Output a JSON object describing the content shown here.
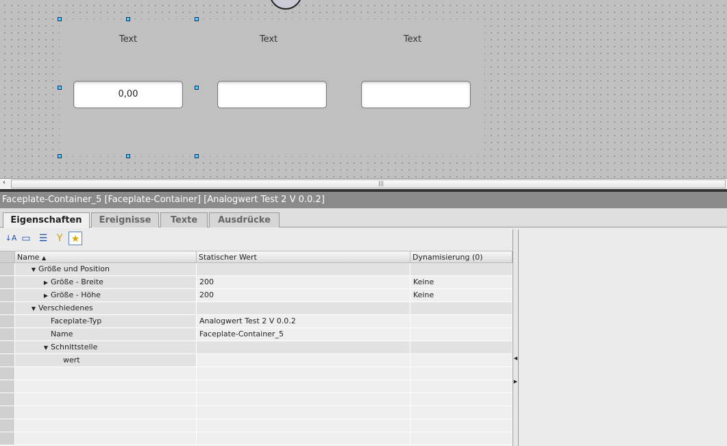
{
  "canvas": {
    "faceplates": [
      {
        "label": "Text",
        "value": "0,00"
      },
      {
        "label": "Text",
        "value": ""
      },
      {
        "label": "Text",
        "value": ""
      }
    ]
  },
  "inspector": {
    "title": "Faceplate-Container_5 [Faceplate-Container] [Analogwert Test 2 V 0.0.2]",
    "tabs": [
      "Eigenschaften",
      "Ereignisse",
      "Texte",
      "Ausdrücke"
    ],
    "toolbar": [
      "sort-az-icon",
      "folder-icon",
      "tree-list-icon",
      "filter-icon",
      "favorites-star-icon"
    ],
    "columns": [
      "Name",
      "Statischer Wert",
      "Dynamisierung (0)"
    ],
    "rows": [
      {
        "name": "Größe und Position",
        "value": "",
        "dyn": "",
        "level": 0,
        "toggle": "expanded",
        "group": true
      },
      {
        "name": "Größe - Breite",
        "value": "200",
        "dyn": "Keine",
        "level": 1,
        "toggle": "collapsed"
      },
      {
        "name": "Größe - Höhe",
        "value": "200",
        "dyn": "Keine",
        "level": 1,
        "toggle": "collapsed"
      },
      {
        "name": "Verschiedenes",
        "value": "",
        "dyn": "",
        "level": 0,
        "toggle": "expanded",
        "group": true
      },
      {
        "name": "Faceplate-Typ",
        "value": "Analogwert Test 2 V 0.0.2",
        "dyn": "",
        "level": 1,
        "toggle": ""
      },
      {
        "name": "Name",
        "value": "Faceplate-Container_5",
        "dyn": "",
        "level": 1,
        "toggle": ""
      },
      {
        "name": "Schnittstelle",
        "value": "",
        "dyn": "",
        "level": 1,
        "toggle": "expanded",
        "group": true
      },
      {
        "name": "wert",
        "value": "",
        "dyn": "",
        "level": 2,
        "toggle": ""
      }
    ]
  }
}
